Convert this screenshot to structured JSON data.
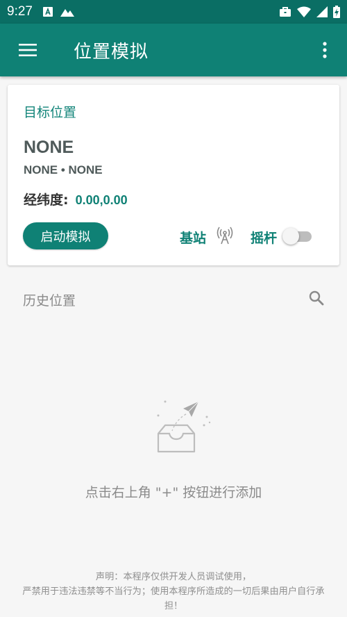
{
  "status_bar": {
    "time": "9:27",
    "left_icons": [
      "font-download-icon",
      "mountain-icon"
    ],
    "right_icons": [
      "briefcase-icon",
      "wifi-icon",
      "signal-icon",
      "battery-charging-icon"
    ]
  },
  "app_bar": {
    "title": "位置模拟",
    "menu_icon": "hamburger-menu-icon",
    "more_icon": "more-vert-icon",
    "background": "#0f8175"
  },
  "target_card": {
    "label": "目标位置",
    "place_name": "NONE",
    "place_sub": "NONE • NONE",
    "coord_label": "经纬度:",
    "coord_value": "0.00,0.00",
    "start_button": "启动模拟",
    "base_station_label": "基站",
    "base_station_icon": "antenna-icon",
    "joystick_label": "摇杆",
    "joystick_enabled": false
  },
  "history": {
    "title": "历史位置",
    "search_icon": "search-icon",
    "empty_icon": "inbox-paper-plane-icon",
    "empty_text": "点击右上角 \"+\" 按钮进行添加"
  },
  "disclaimer": {
    "line1": "声明：本程序仅供开发人员调试使用，",
    "line2": "严禁用于违法违禁等不当行为；使用本程序所造成的一切后果由用户自行承",
    "line3": "担！"
  },
  "colors": {
    "primary": "#0f8175",
    "status_bar": "#0a6e64",
    "background": "#f6f6f6"
  }
}
